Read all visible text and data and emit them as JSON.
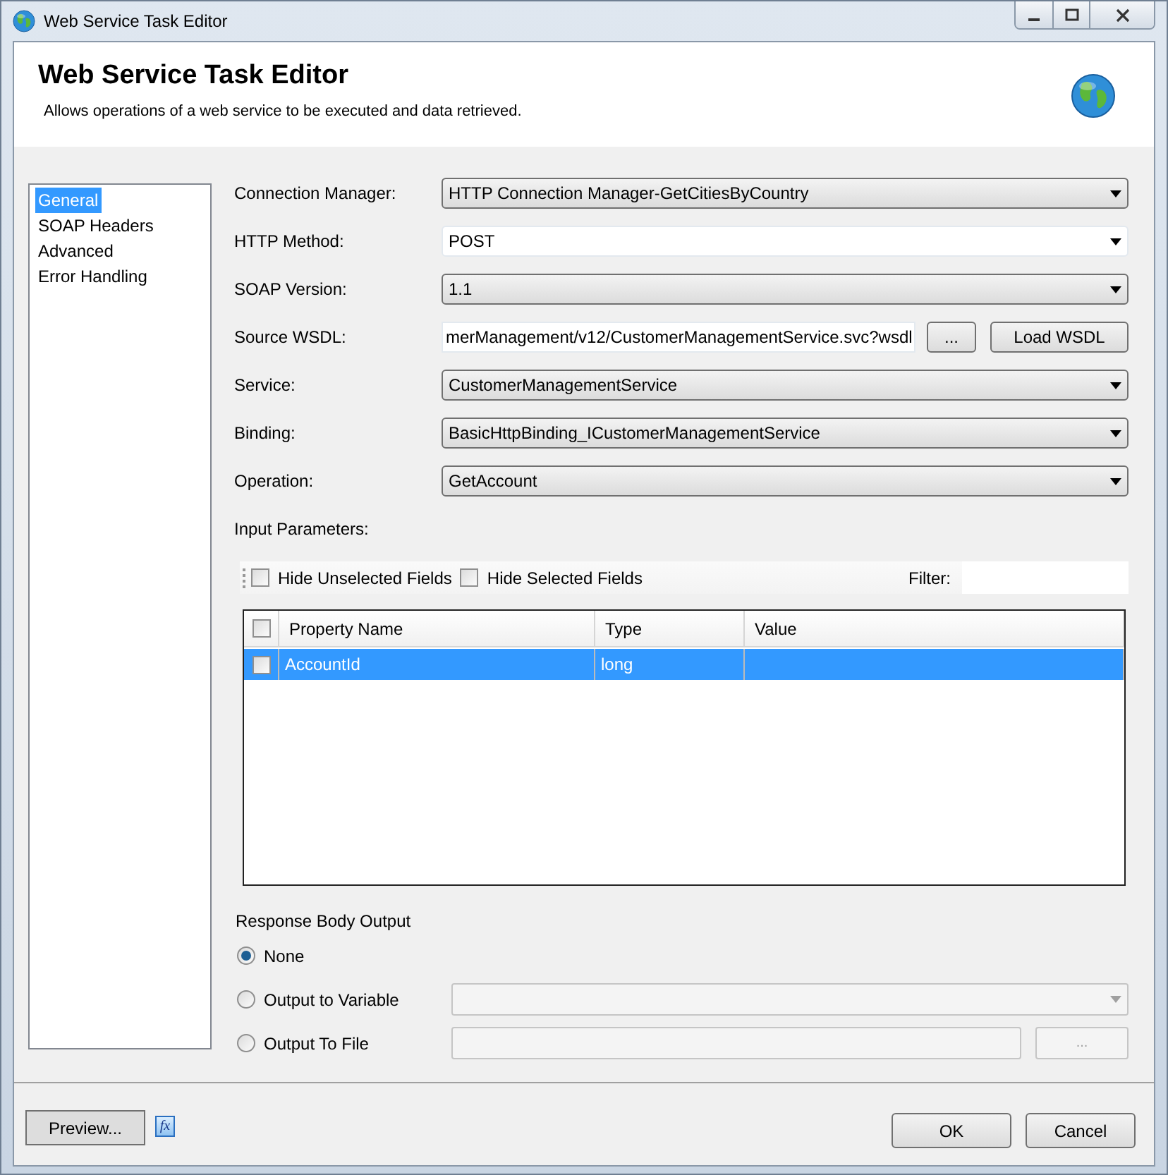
{
  "window": {
    "title": "Web Service Task Editor"
  },
  "header": {
    "title": "Web Service Task Editor",
    "description": "Allows operations of a web service to be executed and data retrieved."
  },
  "nav": {
    "items": [
      {
        "label": "General",
        "selected": true
      },
      {
        "label": "SOAP Headers",
        "selected": false
      },
      {
        "label": "Advanced",
        "selected": false
      },
      {
        "label": "Error Handling",
        "selected": false
      }
    ]
  },
  "form": {
    "fields": [
      {
        "label": "Connection Manager:",
        "kind": "dropdown",
        "value": "HTTP Connection Manager-GetCitiesByCountry"
      },
      {
        "label": "HTTP Method:",
        "kind": "combo",
        "value": "POST"
      },
      {
        "label": "SOAP Version:",
        "kind": "dropdown",
        "value": "1.1"
      },
      {
        "label": "Source WSDL:",
        "kind": "text",
        "value": "merManagement/v12/CustomerManagementService.svc?wsdl",
        "buttons": [
          "...",
          "Load WSDL"
        ]
      },
      {
        "label": "Service:",
        "kind": "dropdown",
        "value": "CustomerManagementService"
      },
      {
        "label": "Binding:",
        "kind": "dropdown",
        "value": "BasicHttpBinding_ICustomerManagementService"
      },
      {
        "label": "Operation:",
        "kind": "dropdown",
        "value": "GetAccount"
      }
    ]
  },
  "input_parameters": {
    "label": "Input Parameters:",
    "toolbar": {
      "checkboxes": [
        {
          "label": "Hide Unselected Fields",
          "checked": false
        },
        {
          "label": "Hide Selected Fields",
          "checked": false
        }
      ],
      "filter_label": "Filter:"
    },
    "grid": {
      "header_checked": false,
      "columns": [
        "Property Name",
        "Type",
        "Value"
      ],
      "rows": [
        {
          "checked": false,
          "selected": true,
          "cells": [
            "AccountId",
            "long"
          ]
        }
      ]
    }
  },
  "response": {
    "label": "Response Body Output",
    "options": [
      {
        "label": "None",
        "selected": true
      },
      {
        "label": "Output to Variable",
        "selected": false,
        "control": {
          "kind": "dropdown",
          "disabled": true
        }
      },
      {
        "label": "Output To File",
        "selected": false,
        "control": {
          "kind": "file",
          "disabled": true,
          "button": "..."
        }
      }
    ]
  },
  "footer": {
    "preview": "Preview...",
    "expression": "fx",
    "ok": "OK",
    "cancel": "Cancel"
  }
}
